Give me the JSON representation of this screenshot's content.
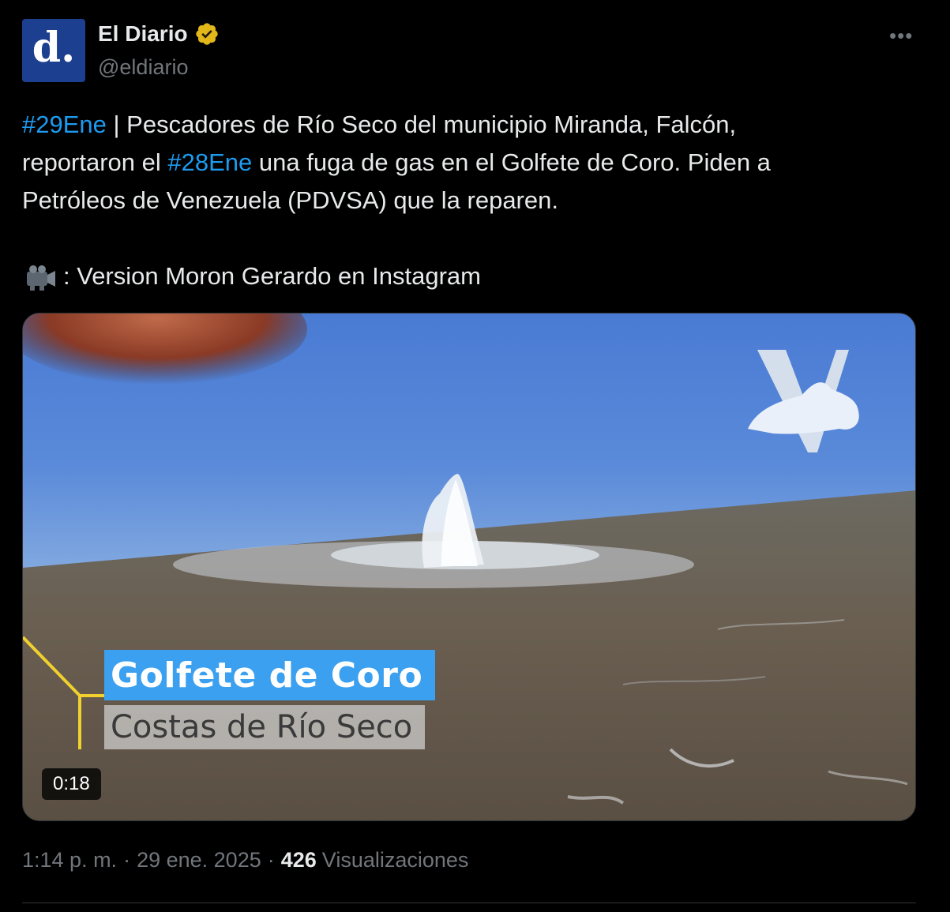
{
  "author": {
    "display_name": "El Diario",
    "handle": "@eldiario",
    "avatar_letter": "d.",
    "avatar_bg": "#1d3f8f",
    "avatar_dot_color": "#f6c12b",
    "verified": true,
    "verified_badge_color": "#e2b719"
  },
  "more_label": "•••",
  "tweet": {
    "lines": [
      [
        {
          "text": "#29Ene",
          "hashtag": true
        },
        {
          "text": " | Pescadores de Río Seco del municipio Miranda, Falcón,",
          "hashtag": false
        }
      ],
      [
        {
          "text": "reportaron el ",
          "hashtag": false
        },
        {
          "text": "#28Ene",
          "hashtag": true
        },
        {
          "text": " una fuga de gas en el Golfete de Coro. Piden a",
          "hashtag": false
        }
      ],
      [
        {
          "text": "Petróleos de Venezuela (PDVSA) que la reparen.",
          "hashtag": false
        }
      ]
    ],
    "credit_icon": "video-camera-icon",
    "credit_text": ": Version Moron Gerardo en Instagram"
  },
  "media": {
    "type": "video",
    "duration": "0:18",
    "overlay_title": "Golfete de Coro",
    "overlay_subtitle": "Costas de Río Seco",
    "overlay_title_bg": "#3aa0ef",
    "watermark": "V"
  },
  "meta": {
    "time": "1:14 p. m.",
    "separator": "·",
    "date": "29 ene. 2025",
    "views_count": "426",
    "views_label": "Visualizaciones"
  },
  "colors": {
    "background": "#000000",
    "text": "#e7e9ea",
    "muted": "#71767b",
    "hashtag": "#1d9bf0",
    "divider": "#2f3336"
  }
}
